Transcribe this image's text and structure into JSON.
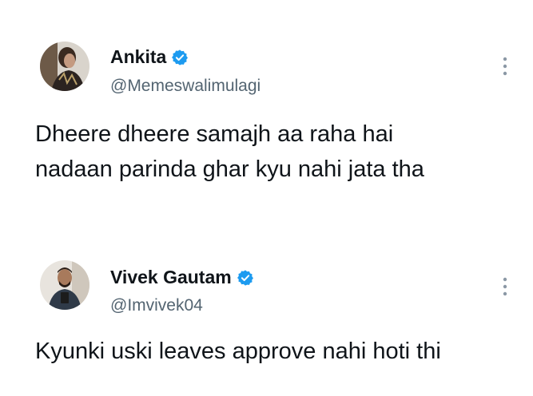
{
  "tweets": [
    {
      "display_name": "Ankita",
      "handle": "@Memeswalimulagi",
      "verified": true,
      "text_lines": [
        "Dheere dheere samajh aa raha hai",
        "nadaan parinda ghar kyu nahi jata tha"
      ]
    },
    {
      "display_name": "Vivek Gautam",
      "handle": "@Imvivek04",
      "verified": true,
      "text_lines": [
        "Kyunki uski leaves approve nahi hoti thi"
      ]
    }
  ],
  "icons": {
    "verified": "verified-badge-icon",
    "more": "more-vertical-icon"
  },
  "colors": {
    "verified_blue": "#1d9bf0",
    "handle_gray": "#536471",
    "text_black": "#0f1419"
  }
}
